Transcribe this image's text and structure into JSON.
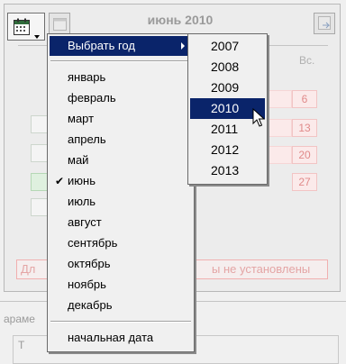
{
  "header": {
    "title": "июнь 2010",
    "sunday_col": "Вс."
  },
  "days": [
    "6",
    "13",
    "20",
    "27"
  ],
  "warning": {
    "head": "Дл",
    "tail": "ы не установлены"
  },
  "params": {
    "label": "араме",
    "sub": "Т"
  },
  "menu": {
    "select_year": "Выбрать год",
    "months": [
      "январь",
      "февраль",
      "март",
      "апрель",
      "май",
      "июнь",
      "июль",
      "август",
      "сентябрь",
      "октябрь",
      "ноябрь",
      "декабрь"
    ],
    "checked_month": "июнь",
    "start_date": "начальная дата"
  },
  "years": {
    "items": [
      "2007",
      "2008",
      "2009",
      "2010",
      "2011",
      "2012",
      "2013"
    ],
    "selected": "2010"
  },
  "colors": {
    "highlight": "#0a246a",
    "highlight_text": "#ffffff",
    "weekend_text": "#e08a8a"
  },
  "icons": [
    "calendar-icon",
    "chevron-down-icon",
    "chevron-right-icon",
    "checkmark-icon",
    "mouse-pointer-icon"
  ]
}
